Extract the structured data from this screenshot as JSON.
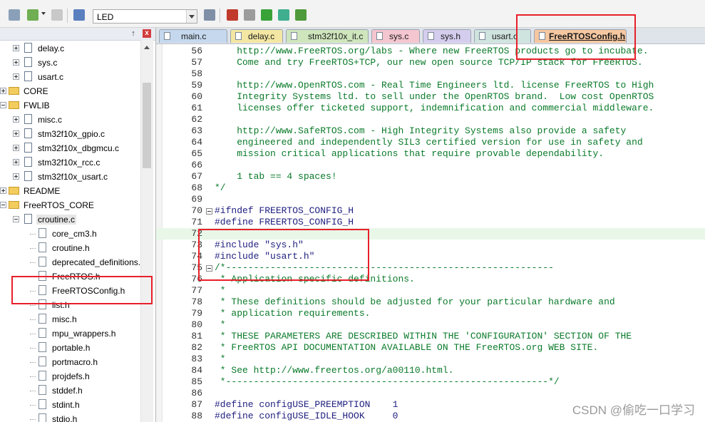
{
  "toolbar": {
    "target_select": "LED",
    "icons": [
      "settings-icon",
      "layers-icon",
      "grid-icon",
      "load-icon",
      "options-icon",
      "manage-icon",
      "copy-icon",
      "download-icon",
      "diamond-icon",
      "pack-icon"
    ]
  },
  "project_panel": {
    "pin": "↑",
    "close": "x",
    "items": [
      {
        "label": "delay.c",
        "kind": "c-file",
        "level": 2,
        "expander": "plus"
      },
      {
        "label": "sys.c",
        "kind": "c-file",
        "level": 2,
        "expander": "plus"
      },
      {
        "label": "usart.c",
        "kind": "c-file",
        "level": 2,
        "expander": "plus"
      },
      {
        "label": "CORE",
        "kind": "folder",
        "level": 1,
        "expander": "plus"
      },
      {
        "label": "FWLIB",
        "kind": "folder",
        "level": 1,
        "expander": "minus"
      },
      {
        "label": "misc.c",
        "kind": "c-file",
        "level": 2,
        "expander": "plus"
      },
      {
        "label": "stm32f10x_gpio.c",
        "kind": "c-file",
        "level": 2,
        "expander": "plus"
      },
      {
        "label": "stm32f10x_dbgmcu.c",
        "kind": "c-file",
        "level": 2,
        "expander": "plus"
      },
      {
        "label": "stm32f10x_rcc.c",
        "kind": "c-file",
        "level": 2,
        "expander": "plus"
      },
      {
        "label": "stm32f10x_usart.c",
        "kind": "c-file",
        "level": 2,
        "expander": "plus"
      },
      {
        "label": "README",
        "kind": "folder",
        "level": 1,
        "expander": "plus"
      },
      {
        "label": "FreeRTOS_CORE",
        "kind": "folder",
        "level": 1,
        "expander": "minus"
      },
      {
        "label": "croutine.c",
        "kind": "c-file",
        "level": 2,
        "expander": "minus",
        "selected": true
      },
      {
        "label": "core_cm3.h",
        "kind": "h-file",
        "level": 3
      },
      {
        "label": "croutine.h",
        "kind": "h-file",
        "level": 3
      },
      {
        "label": "deprecated_definitions.",
        "kind": "h-file",
        "level": 3
      },
      {
        "label": "FreeRTOS.h",
        "kind": "h-file",
        "level": 3
      },
      {
        "label": "FreeRTOSConfig.h",
        "kind": "h-file",
        "level": 3
      },
      {
        "label": "list.h",
        "kind": "h-file",
        "level": 3
      },
      {
        "label": "misc.h",
        "kind": "h-file",
        "level": 3
      },
      {
        "label": "mpu_wrappers.h",
        "kind": "h-file",
        "level": 3
      },
      {
        "label": "portable.h",
        "kind": "h-file",
        "level": 3
      },
      {
        "label": "portmacro.h",
        "kind": "h-file",
        "level": 3
      },
      {
        "label": "projdefs.h",
        "kind": "h-file",
        "level": 3
      },
      {
        "label": "stddef.h",
        "kind": "h-file",
        "level": 3
      },
      {
        "label": "stdint.h",
        "kind": "h-file",
        "level": 3
      },
      {
        "label": "stdio.h",
        "kind": "h-file",
        "level": 3
      }
    ]
  },
  "tabs": [
    {
      "label": "main.c",
      "color": "#c5d8ee"
    },
    {
      "label": "delay.c",
      "color": "#f4e7a3"
    },
    {
      "label": "stm32f10x_it.c",
      "color": "#cfe6bd"
    },
    {
      "label": "sys.c",
      "color": "#f4c6cf"
    },
    {
      "label": "sys.h",
      "color": "#d5cdee"
    },
    {
      "label": "usart.c",
      "color": "#cfe3df"
    },
    {
      "label": "FreeRTOSConfig.h",
      "color": "#f6c7a0",
      "active": true
    }
  ],
  "editor": {
    "lines": [
      {
        "n": "56",
        "text": "    http://www.FreeRTOS.org/labs - Where new FreeRTOS products go to incubate.",
        "style": "comment"
      },
      {
        "n": "57",
        "text": "    Come and try FreeRTOS+TCP, our new open source TCP/IP stack for FreeRTOS.",
        "style": "comment"
      },
      {
        "n": "58",
        "text": "",
        "style": "comment"
      },
      {
        "n": "59",
        "text": "    http://www.OpenRTOS.com - Real Time Engineers ltd. license FreeRTOS to High",
        "style": "comment"
      },
      {
        "n": "60",
        "text": "    Integrity Systems ltd. to sell under the OpenRTOS brand.  Low cost OpenRTOS",
        "style": "comment"
      },
      {
        "n": "61",
        "text": "    licenses offer ticketed support, indemnification and commercial middleware.",
        "style": "comment"
      },
      {
        "n": "62",
        "text": "",
        "style": "comment"
      },
      {
        "n": "63",
        "text": "    http://www.SafeRTOS.com - High Integrity Systems also provide a safety",
        "style": "comment"
      },
      {
        "n": "64",
        "text": "    engineered and independently SIL3 certified version for use in safety and",
        "style": "comment"
      },
      {
        "n": "65",
        "text": "    mission critical applications that require provable dependability.",
        "style": "comment"
      },
      {
        "n": "66",
        "text": "",
        "style": "comment"
      },
      {
        "n": "67",
        "text": "    1 tab == 4 spaces!",
        "style": "comment"
      },
      {
        "n": "68",
        "text": "*/",
        "style": "comment"
      },
      {
        "n": "69",
        "text": "",
        "style": "def"
      },
      {
        "n": "70",
        "text": "#ifndef FREERTOS_CONFIG_H",
        "style": "pp",
        "fold": true
      },
      {
        "n": "71",
        "text": "#define FREERTOS_CONFIG_H",
        "style": "pp"
      },
      {
        "n": "72",
        "text": "",
        "style": "def",
        "highlight": true
      },
      {
        "n": "73",
        "text": "#include \"sys.h\"",
        "style": "pp"
      },
      {
        "n": "74",
        "text": "#include \"usart.h\"",
        "style": "pp"
      },
      {
        "n": "75",
        "text": "/*-----------------------------------------------------------",
        "style": "comment",
        "fold": true
      },
      {
        "n": "76",
        "text": " * Application specific definitions.",
        "style": "comment"
      },
      {
        "n": "77",
        "text": " *",
        "style": "comment"
      },
      {
        "n": "78",
        "text": " * These definitions should be adjusted for your particular hardware and",
        "style": "comment"
      },
      {
        "n": "79",
        "text": " * application requirements.",
        "style": "comment"
      },
      {
        "n": "80",
        "text": " *",
        "style": "comment"
      },
      {
        "n": "81",
        "text": " * THESE PARAMETERS ARE DESCRIBED WITHIN THE 'CONFIGURATION' SECTION OF THE",
        "style": "comment"
      },
      {
        "n": "82",
        "text": " * FreeRTOS API DOCUMENTATION AVAILABLE ON THE FreeRTOS.org WEB SITE.",
        "style": "comment"
      },
      {
        "n": "83",
        "text": " *",
        "style": "comment"
      },
      {
        "n": "84",
        "text": " * See http://www.freertos.org/a00110.html.",
        "style": "comment"
      },
      {
        "n": "85",
        "text": " *----------------------------------------------------------*/",
        "style": "comment"
      },
      {
        "n": "86",
        "text": "",
        "style": "def"
      },
      {
        "n": "87",
        "text": "#define configUSE_PREEMPTION    1",
        "style": "pp"
      },
      {
        "n": "88",
        "text": "#define configUSE_IDLE_HOOK     0",
        "style": "pp"
      }
    ]
  },
  "watermark": "CSDN @偷吃一口学习",
  "colors": {
    "annotation": "#e8202a",
    "comment": "#0a7a2a",
    "highlight": "#e8f7e8"
  }
}
